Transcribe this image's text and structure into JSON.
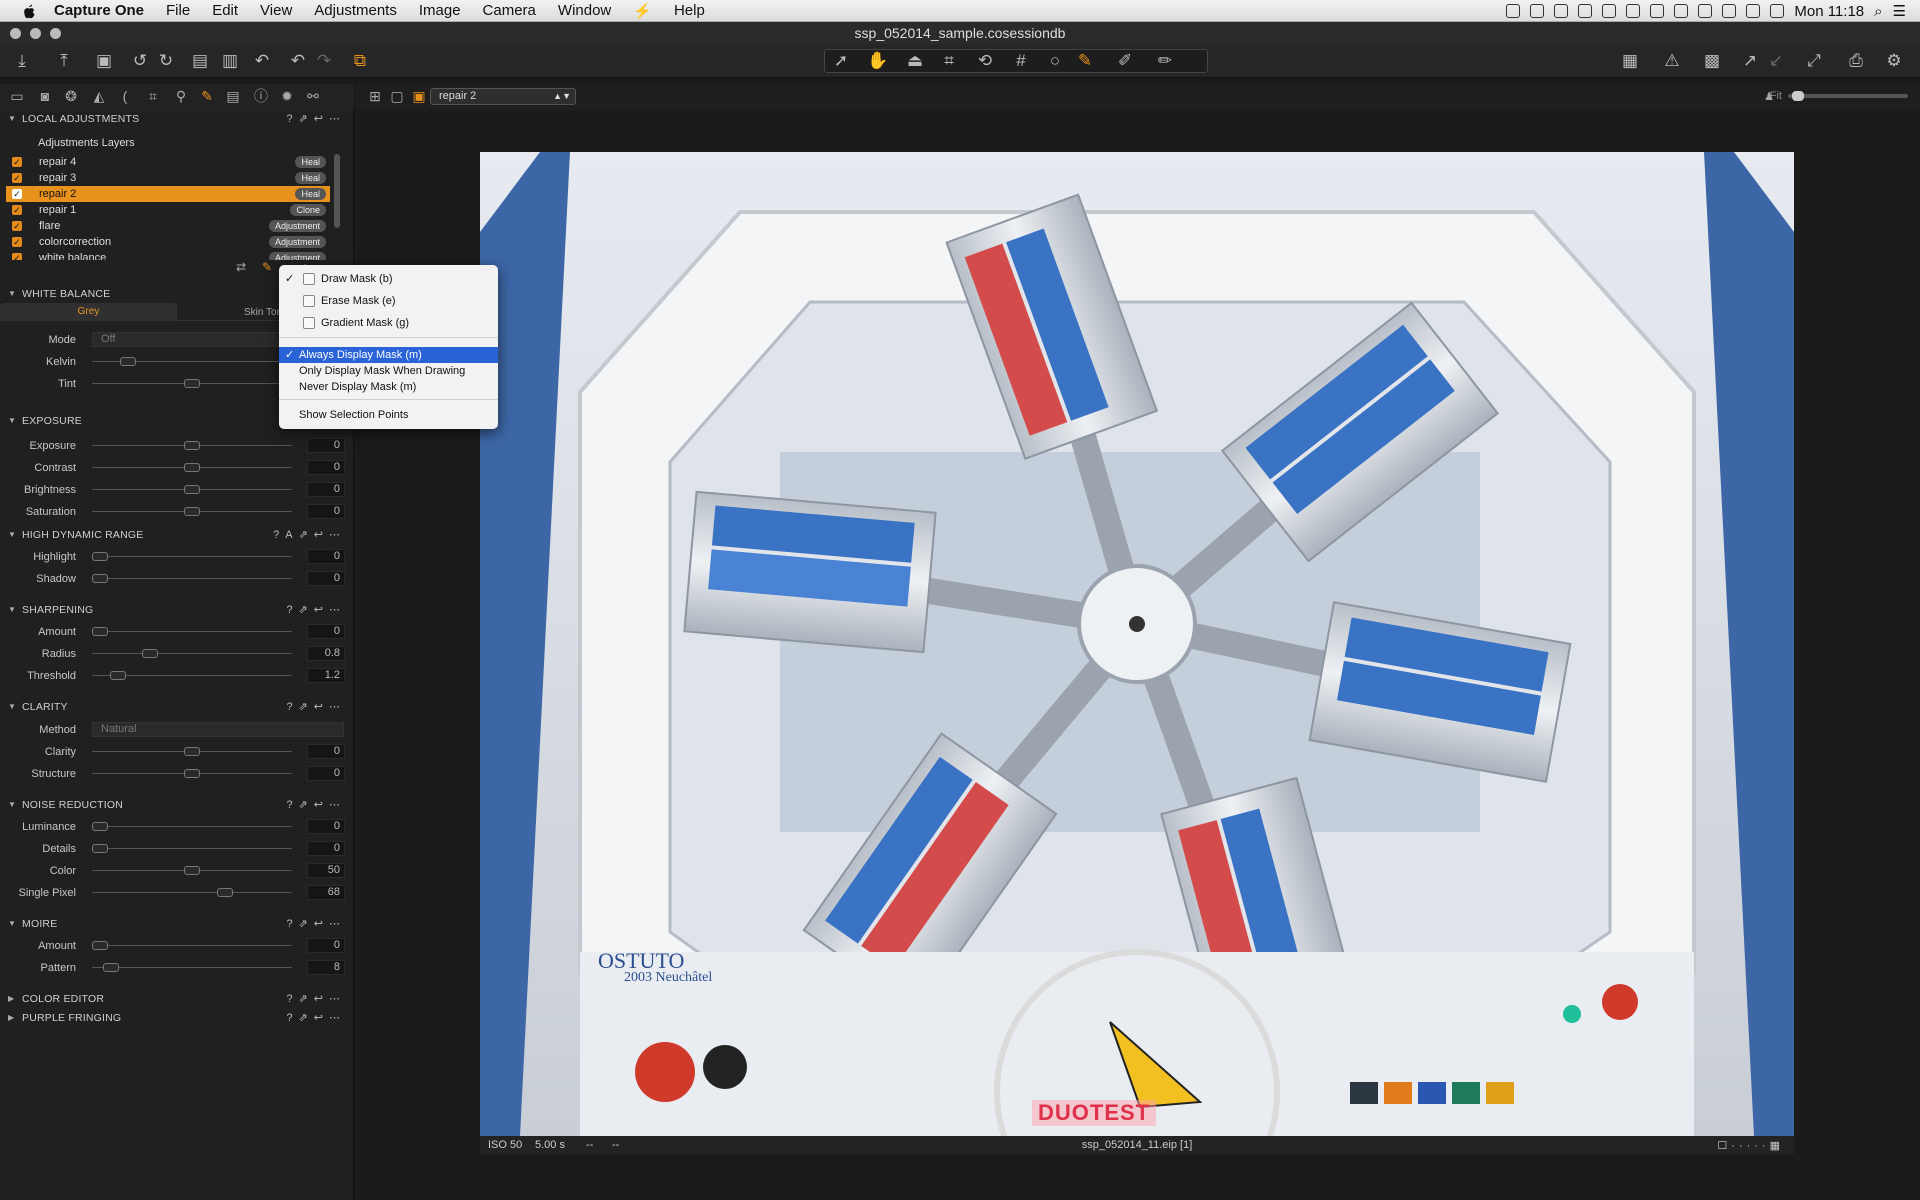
{
  "menubar": {
    "app": "Capture One",
    "items": [
      "File",
      "Edit",
      "View",
      "Adjustments",
      "Image",
      "Camera",
      "Window",
      "Help"
    ],
    "clock": "Mon 11:18"
  },
  "window": {
    "title": "ssp_052014_sample.cosessiondb"
  },
  "toolbar": {
    "viewer_variant": "repair 2",
    "zoom_label": "Fit"
  },
  "local_adjustments": {
    "title": "LOCAL ADJUSTMENTS",
    "layers_title": "Adjustments Layers",
    "layers": [
      {
        "name": "repair 4",
        "badge": "Heal"
      },
      {
        "name": "repair 3",
        "badge": "Heal"
      },
      {
        "name": "repair 2",
        "badge": "Heal"
      },
      {
        "name": "repair 1",
        "badge": "Clone"
      },
      {
        "name": "flare",
        "badge": "Adjustment"
      },
      {
        "name": "colorcorrection",
        "badge": "Adjustment"
      },
      {
        "name": "white balance",
        "badge": "Adjustment"
      }
    ]
  },
  "white_balance": {
    "title": "WHITE BALANCE",
    "tab_grey": "Grey",
    "tab_skin": "Skin Tone",
    "mode_label": "Mode",
    "mode_value": "Off",
    "kelvin_label": "Kelvin",
    "kelvin_level": 0.15,
    "tint_label": "Tint",
    "tint_level": 0.5
  },
  "exposure": {
    "title": "EXPOSURE",
    "rows": [
      {
        "label": "Exposure",
        "value": "0",
        "level": 0.5
      },
      {
        "label": "Contrast",
        "value": "0",
        "level": 0.5
      },
      {
        "label": "Brightness",
        "value": "0",
        "level": 0.5
      },
      {
        "label": "Saturation",
        "value": "0",
        "level": 0.5
      }
    ]
  },
  "hdr": {
    "title": "HIGH DYNAMIC RANGE",
    "rows": [
      {
        "label": "Highlight",
        "value": "0",
        "level": 0
      },
      {
        "label": "Shadow",
        "value": "0",
        "level": 0
      }
    ]
  },
  "sharpening": {
    "title": "SHARPENING",
    "rows": [
      {
        "label": "Amount",
        "value": "0",
        "level": 0
      },
      {
        "label": "Radius",
        "value": "0.8",
        "level": 0.27
      },
      {
        "label": "Threshold",
        "value": "1.2",
        "level": 0.1
      }
    ]
  },
  "clarity": {
    "title": "CLARITY",
    "method_label": "Method",
    "method_value": "Natural",
    "rows": [
      {
        "label": "Clarity",
        "value": "0",
        "level": 0.5
      },
      {
        "label": "Structure",
        "value": "0",
        "level": 0.5
      }
    ]
  },
  "noise_reduction": {
    "title": "NOISE REDUCTION",
    "rows": [
      {
        "label": "Luminance",
        "value": "0",
        "level": 0
      },
      {
        "label": "Details",
        "value": "0",
        "level": 0
      },
      {
        "label": "Color",
        "value": "50",
        "level": 0.5
      },
      {
        "label": "Single Pixel",
        "value": "68",
        "level": 0.68
      }
    ]
  },
  "moire": {
    "title": "MOIRE",
    "rows": [
      {
        "label": "Amount",
        "value": "0",
        "level": 0
      },
      {
        "label": "Pattern",
        "value": "8",
        "level": 0.06
      }
    ]
  },
  "collapsed": {
    "color_editor": "COLOR EDITOR",
    "purple_fringing": "PURPLE FRINGING"
  },
  "context_menu": {
    "draw_mask": "Draw Mask (b)",
    "erase_mask": "Erase Mask (e)",
    "gradient_mask": "Gradient Mask (g)",
    "always_display": "Always Display Mask (m)",
    "only_display": "Only Display Mask When Drawing",
    "never_display": "Never Display Mask (m)",
    "show_points": "Show Selection Points"
  },
  "info": {
    "iso": "ISO 50",
    "shutter": "5.00 s",
    "dash1": "--",
    "dash2": "--",
    "filename": "ssp_052014_11.eip [1]"
  },
  "photo": {
    "brand": "OSTUTO",
    "city": "2003 Neuchâtel",
    "logo": "DUOTEST"
  },
  "colors": {
    "accent": "#e8921e",
    "panel": "#202020",
    "menu_highlight": "#2a63d8"
  }
}
